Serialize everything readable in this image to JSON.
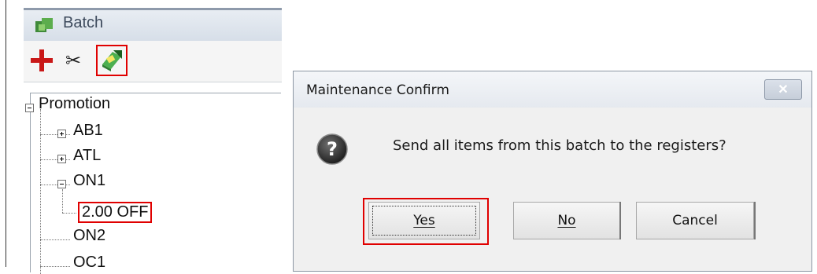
{
  "panel": {
    "title": "Batch",
    "tree": {
      "root": "Promotion",
      "children": [
        "AB1",
        "ATL",
        "ON1",
        "2.00 OFF",
        "ON2",
        "OC1"
      ]
    },
    "toolbar": {
      "add_icon": "plus-icon",
      "cut_icon": "scissors-icon",
      "send_icon": "send-to-registers-icon"
    }
  },
  "dialog": {
    "title": "Maintenance Confirm",
    "close_symbol": "✕",
    "message": "Send all items from this batch to the registers?",
    "buttons": {
      "yes": "Yes",
      "no": "No",
      "cancel": "Cancel"
    }
  }
}
